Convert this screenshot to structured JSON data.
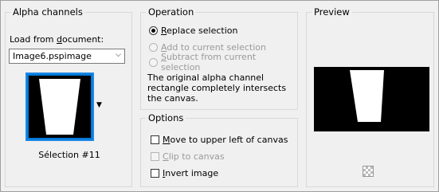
{
  "alpha_channels": {
    "title": "Alpha channels",
    "load_label": "Load from document:",
    "document_value": "Image6.pspimage",
    "selection_label": "Sélection #11"
  },
  "operation": {
    "title": "Operation",
    "options": [
      {
        "label": "Replace selection",
        "selected": true,
        "enabled": true
      },
      {
        "label": "Add to current selection",
        "selected": false,
        "enabled": false
      },
      {
        "label": "Subtract from current selection",
        "selected": false,
        "enabled": false
      }
    ],
    "description": "The original alpha channel rectangle completely intersects the canvas."
  },
  "options": {
    "title": "Options",
    "items": [
      {
        "label": "Move to upper left of canvas",
        "checked": false,
        "enabled": true
      },
      {
        "label": "Clip to canvas",
        "checked": false,
        "enabled": false
      },
      {
        "label": "Invert image",
        "checked": false,
        "enabled": true
      }
    ]
  },
  "preview": {
    "title": "Preview"
  },
  "icons": {
    "dropdown": "chevron-down-icon",
    "transparency": "checkerboard-icon"
  },
  "colors": {
    "accent": "#0078d7",
    "background": "#f0f0f0",
    "disabled_text": "#9a9a9a"
  }
}
